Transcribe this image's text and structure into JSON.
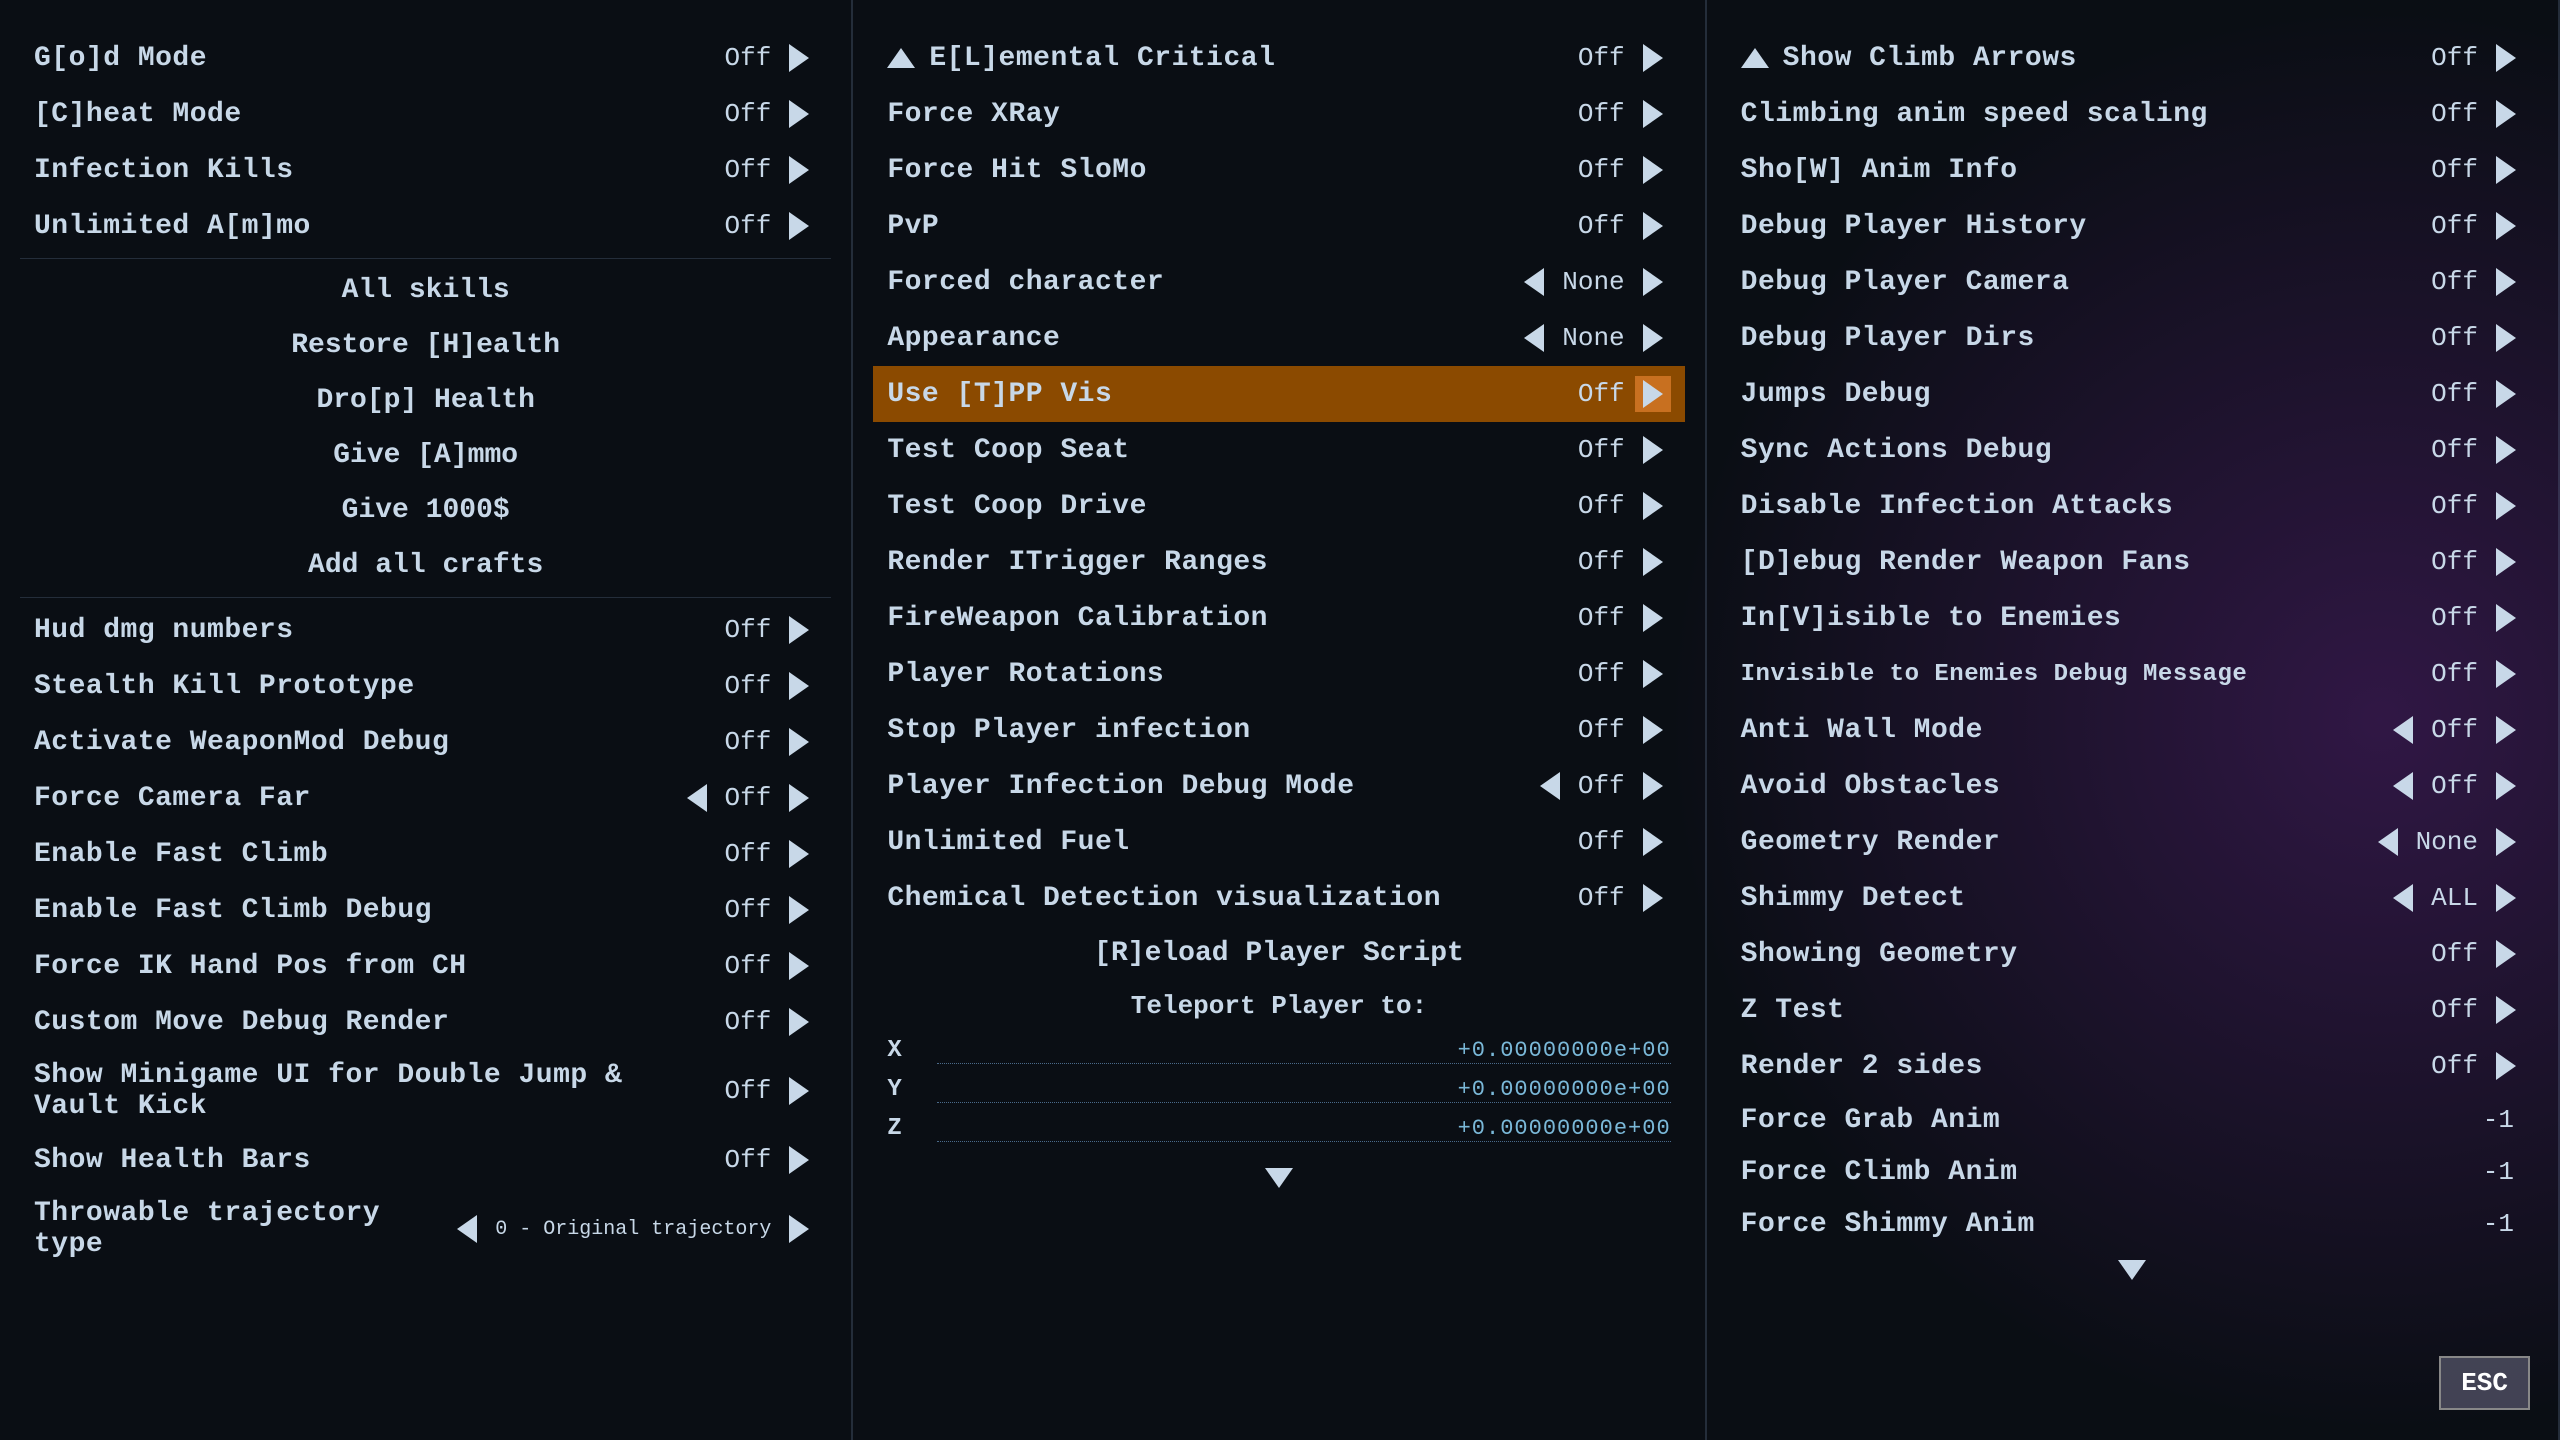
{
  "columns": [
    {
      "id": "col1",
      "items": [
        {
          "id": "gold-mode",
          "label": "G[o]d Mode",
          "value": "Off",
          "hasLeft": false,
          "hasRight": true
        },
        {
          "id": "cheat-mode",
          "label": "[C]heat Mode",
          "value": "Off",
          "hasLeft": false,
          "hasRight": true
        },
        {
          "id": "infection-kills",
          "label": "Infection Kills",
          "value": "Off",
          "hasLeft": false,
          "hasRight": true
        },
        {
          "id": "unlimited-ammo",
          "label": "Unlimited A[m]mo",
          "value": "Off",
          "hasLeft": false,
          "hasRight": true
        }
      ],
      "buttons": [
        {
          "id": "all-skills",
          "label": "All skills"
        },
        {
          "id": "restore-health",
          "label": "Restore [H]ealth"
        },
        {
          "id": "drop-health",
          "label": "Dro[p] Health"
        },
        {
          "id": "give-ammo",
          "label": "Give [A]mmo"
        },
        {
          "id": "give-1000",
          "label": "Give 1000$"
        },
        {
          "id": "add-crafts",
          "label": "Add all crafts"
        }
      ],
      "items2": [
        {
          "id": "hud-dmg",
          "label": "Hud dmg numbers",
          "value": "Off",
          "hasLeft": false,
          "hasRight": true
        },
        {
          "id": "stealth-kill",
          "label": "Stealth Kill Prototype",
          "value": "Off",
          "hasLeft": false,
          "hasRight": true
        },
        {
          "id": "weaponmod-debug",
          "label": "Activate WeaponMod Debug",
          "value": "Off",
          "hasLeft": false,
          "hasRight": true
        },
        {
          "id": "camera-far",
          "label": "Force Camera Far",
          "value": "Off",
          "hasLeft": true,
          "hasRight": true
        },
        {
          "id": "fast-climb",
          "label": "Enable Fast Climb",
          "value": "Off",
          "hasLeft": false,
          "hasRight": true
        },
        {
          "id": "fast-climb-debug",
          "label": "Enable Fast Climb Debug",
          "value": "Off",
          "hasLeft": false,
          "hasRight": true
        },
        {
          "id": "ik-hand",
          "label": "Force IK Hand Pos from CH",
          "value": "Off",
          "hasLeft": false,
          "hasRight": true
        },
        {
          "id": "custom-move",
          "label": "Custom Move Debug Render",
          "value": "Off",
          "hasLeft": false,
          "hasRight": true
        },
        {
          "id": "minigame-ui",
          "label": "Show Minigame UI for Double Jump & Vault Kick",
          "value": "Off",
          "hasLeft": false,
          "hasRight": true
        },
        {
          "id": "health-bars",
          "label": "Show Health Bars",
          "value": "Off",
          "hasLeft": false,
          "hasRight": true
        },
        {
          "id": "throwable-traj",
          "label": "Throwable trajectory type",
          "value": "0 - Original trajectory",
          "hasLeft": true,
          "hasRight": true
        }
      ]
    },
    {
      "id": "col2",
      "header": {
        "label": "E[L]emental Critical",
        "value": "Off",
        "isUp": true
      },
      "items": [
        {
          "id": "force-xray",
          "label": "Force XRay",
          "value": "Off",
          "hasLeft": false,
          "hasRight": true
        },
        {
          "id": "force-hit-slomo",
          "label": "Force Hit SloMo",
          "value": "Off",
          "hasLeft": false,
          "hasRight": true
        },
        {
          "id": "pvp",
          "label": "PvP",
          "value": "Off",
          "hasLeft": false,
          "hasRight": true
        },
        {
          "id": "forced-char",
          "label": "Forced character",
          "value": "None",
          "hasLeft": true,
          "hasRight": true
        },
        {
          "id": "appearance",
          "label": "Appearance",
          "value": "None",
          "hasLeft": true,
          "hasRight": true
        },
        {
          "id": "use-tpp-vis",
          "label": "Use [T]PP Vis",
          "value": "Off",
          "hasLeft": false,
          "hasRight": true,
          "highlighted": true
        },
        {
          "id": "test-coop-seat",
          "label": "Test Coop Seat",
          "value": "Off",
          "hasLeft": false,
          "hasRight": true
        },
        {
          "id": "test-coop-drive",
          "label": "Test Coop Drive",
          "value": "Off",
          "hasLeft": false,
          "hasRight": true
        },
        {
          "id": "render-itrigger",
          "label": "Render ITrigger Ranges",
          "value": "Off",
          "hasLeft": false,
          "hasRight": true
        },
        {
          "id": "fireweapon-calib",
          "label": "FireWeapon Calibration",
          "value": "Off",
          "hasLeft": false,
          "hasRight": true
        },
        {
          "id": "player-rotations",
          "label": "Player Rotations",
          "value": "Off",
          "hasLeft": false,
          "hasRight": true
        },
        {
          "id": "stop-infection",
          "label": "Stop Player infection",
          "value": "Off",
          "hasLeft": false,
          "hasRight": true
        },
        {
          "id": "player-infect-debug",
          "label": "Player Infection Debug Mode",
          "value": "Off",
          "hasLeft": true,
          "hasRight": true
        },
        {
          "id": "unlimited-fuel",
          "label": "Unlimited Fuel",
          "value": "Off",
          "hasLeft": false,
          "hasRight": true
        },
        {
          "id": "chem-detection",
          "label": "Chemical Detection visualization",
          "value": "Off",
          "hasLeft": false,
          "hasRight": true
        }
      ],
      "reload_btn": "[R]eload Player Script",
      "teleport": {
        "title": "Teleport Player to:",
        "coords": [
          {
            "axis": "X",
            "value": "+0.00000000e+00"
          },
          {
            "axis": "Y",
            "value": "+0.00000000e+00"
          },
          {
            "axis": "Z",
            "value": "+0.00000000e+00"
          }
        ]
      }
    },
    {
      "id": "col3",
      "items": [
        {
          "id": "show-climb-arrows",
          "label": "Show Climb Arrows",
          "value": "Off",
          "hasLeft": false,
          "hasRight": true,
          "isHeader": true
        },
        {
          "id": "climbing-anim-speed",
          "label": "Climbing anim speed scaling",
          "value": "Off",
          "hasLeft": false,
          "hasRight": true
        },
        {
          "id": "show-anim-info",
          "label": "Sho[W] Anim Info",
          "value": "Off",
          "hasLeft": false,
          "hasRight": true
        },
        {
          "id": "debug-player-history",
          "label": "Debug Player History",
          "value": "Off",
          "hasLeft": false,
          "hasRight": true
        },
        {
          "id": "debug-player-camera",
          "label": "Debug Player Camera",
          "value": "Off",
          "hasLeft": false,
          "hasRight": true
        },
        {
          "id": "debug-player-dirs",
          "label": "Debug Player Dirs",
          "value": "Off",
          "hasLeft": false,
          "hasRight": true
        },
        {
          "id": "jumps-debug",
          "label": "Jumps Debug",
          "value": "Off",
          "hasLeft": false,
          "hasRight": true
        },
        {
          "id": "sync-actions-debug",
          "label": "Sync Actions Debug",
          "value": "Off",
          "hasLeft": false,
          "hasRight": true
        },
        {
          "id": "disable-infection",
          "label": "Disable Infection Attacks",
          "value": "Off",
          "hasLeft": false,
          "hasRight": true
        },
        {
          "id": "debug-render-weapon",
          "label": "[D]ebug Render Weapon Fans",
          "value": "Off",
          "hasLeft": false,
          "hasRight": true
        },
        {
          "id": "invisible-enemies",
          "label": "In[V]isible to Enemies",
          "value": "Off",
          "hasLeft": false,
          "hasRight": true
        },
        {
          "id": "invisible-debug",
          "label": "Invisible to Enemies Debug Message",
          "value": "Off",
          "hasLeft": false,
          "hasRight": true
        },
        {
          "id": "anti-wall",
          "label": "Anti Wall Mode",
          "value": "Off",
          "hasLeft": true,
          "hasRight": true
        },
        {
          "id": "avoid-obstacles",
          "label": "Avoid Obstacles",
          "value": "Off",
          "hasLeft": true,
          "hasRight": true
        },
        {
          "id": "geometry-render",
          "label": "Geometry Render",
          "value": "None",
          "hasLeft": true,
          "hasRight": true
        },
        {
          "id": "shimmy-detect",
          "label": "Shimmy Detect",
          "value": "ALL",
          "hasLeft": true,
          "hasRight": true
        },
        {
          "id": "showing-geometry",
          "label": "Showing Geometry",
          "value": "Off",
          "hasLeft": false,
          "hasRight": true
        },
        {
          "id": "z-test",
          "label": "Z Test",
          "value": "Off",
          "hasLeft": false,
          "hasRight": true
        },
        {
          "id": "render-2sides",
          "label": "Render 2 sides",
          "value": "Off",
          "hasLeft": false,
          "hasRight": true
        },
        {
          "id": "force-grab-anim",
          "label": "Force Grab Anim",
          "value": "-1",
          "hasLeft": false,
          "hasRight": false
        },
        {
          "id": "force-climb-anim",
          "label": "Force Climb Anim",
          "value": "-1",
          "hasLeft": false,
          "hasRight": false
        },
        {
          "id": "force-shimmy-anim",
          "label": "Force Shimmy Anim",
          "value": "-1",
          "hasLeft": false,
          "hasRight": false
        }
      ]
    }
  ],
  "esc_label": "ESC",
  "cursor": "▶"
}
